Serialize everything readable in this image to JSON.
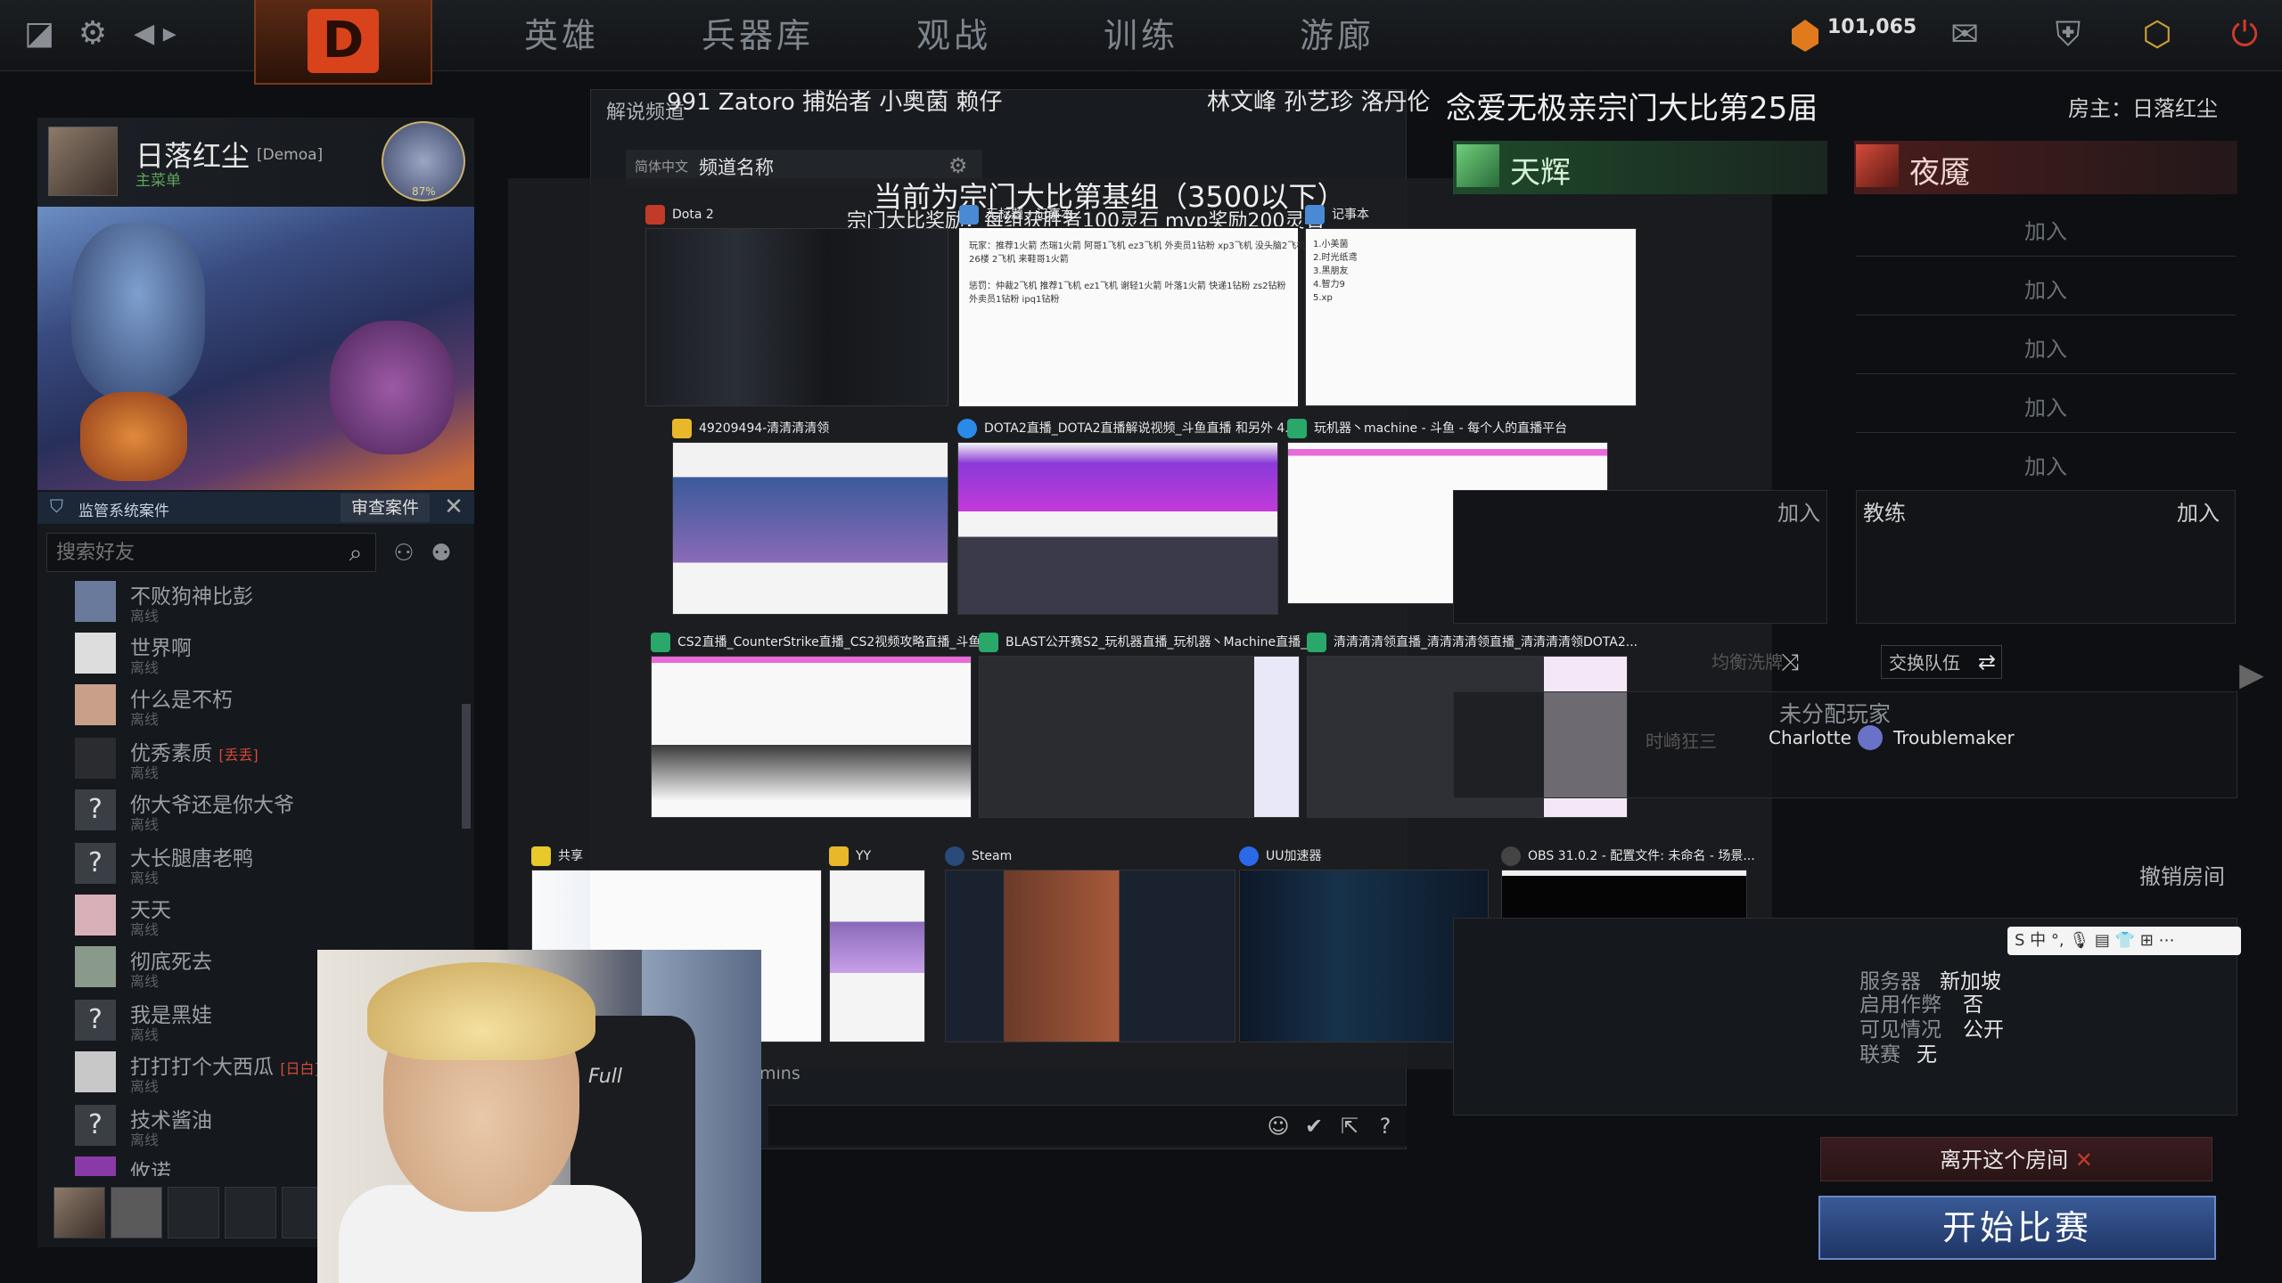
{
  "topbar": {
    "tabs": [
      "英雄",
      "兵器库",
      "观战",
      "训练",
      "游廊"
    ],
    "coins": "101,065"
  },
  "profile": {
    "name": "日落红尘",
    "tag": "[Demoa]",
    "menu": "主菜单",
    "badge_percent": "87%"
  },
  "report": {
    "label": "监管系统案件",
    "button": "审查案件"
  },
  "friends": {
    "search_placeholder": "搜索好友",
    "items": [
      {
        "name": "不败狗神比彭",
        "status": "离线",
        "clan": ""
      },
      {
        "name": "世界啊",
        "status": "离线",
        "clan": ""
      },
      {
        "name": "什么是不朽",
        "status": "离线",
        "clan": ""
      },
      {
        "name": "优秀素质",
        "status": "离线",
        "clan": "[丢丢]"
      },
      {
        "name": "你大爷还是你大爷",
        "status": "离线",
        "clan": ""
      },
      {
        "name": "大长腿唐老鸭",
        "status": "离线",
        "clan": ""
      },
      {
        "name": "天天",
        "status": "离线",
        "clan": ""
      },
      {
        "name": "彻底死去",
        "status": "离线",
        "clan": ""
      },
      {
        "name": "我是黑娃",
        "status": "离线",
        "clan": ""
      },
      {
        "name": "打打打个大西瓜",
        "status": "离线",
        "clan": "[日白]"
      },
      {
        "name": "技术酱油",
        "status": "离线",
        "clan": ""
      },
      {
        "name": "攸诺",
        "status": "",
        "clan": ""
      }
    ]
  },
  "room": {
    "tab_header": "解说频道",
    "viewers_left": "991  Zatoro  捕始者  小奥菌  赖仔",
    "viewers_right": "林文峰  孙艺珍  洛丹伦",
    "channel_lang": "简体中文",
    "channel_name": "频道名称",
    "mins_text": "mins",
    "title": "念爱无极亲宗门大比第25届",
    "host": "房主：日落红尘",
    "radiant": "天辉",
    "dire": "夜魇",
    "join": "加入",
    "coach": "教练",
    "balance": "均衡洗牌",
    "swap": "交换队伍",
    "unassigned_title": "未分配玩家",
    "unassigned": [
      "时崎狂三",
      "Charlotte",
      "Troublemaker"
    ],
    "cancel": "撤销房间",
    "info": [
      {
        "k": "服务器",
        "v": "新加坡"
      },
      {
        "k": "启用作弊",
        "v": "否"
      },
      {
        "k": "可见情况",
        "v": "公开"
      },
      {
        "k": "联赛",
        "v": "无"
      }
    ],
    "leave": "离开这个房间",
    "start": "开始比赛",
    "ime": "S 中 °, 🎙 ▤ 👕 ⊞ ⋯"
  },
  "switcher": {
    "title": "当前为宗门大比第基组（3500以下）",
    "subtitle": "宗门大比奖励：每组获胜者100灵石 mvp奖励200灵石",
    "windows": [
      {
        "title": "Dota 2",
        "icon_color": "#c23a2a"
      },
      {
        "title": "无标题 - 记事本",
        "icon_color": "#4a8ad4"
      },
      {
        "title": "记事本",
        "icon_color": "#4a8ad4"
      },
      {
        "title": "49209494-清清清清领",
        "icon_color": "#e8b82a"
      },
      {
        "title": "DOTA2直播_DOTA2直播解说视频_斗鱼直播 和另外 4...",
        "icon_color": "#2a8ae8"
      },
      {
        "title": "玩机器丶machine - 斗鱼 - 每个人的直播平台",
        "icon_color": "#2aa86a"
      },
      {
        "title": "CS2直播_CounterStrike直播_CS2视频攻略直播_斗鱼...",
        "icon_color": "#2aa86a"
      },
      {
        "title": "BLAST公开赛S2_玩机器直播_玩机器丶Machine直播_...",
        "icon_color": "#2aa86a"
      },
      {
        "title": "清清清清领直播_清清清清领直播_清清清清领DOTA2...",
        "icon_color": "#2aa86a"
      },
      {
        "title": "共享",
        "icon_color": "#e8c82a"
      },
      {
        "title": "YY",
        "icon_color": "#e8b82a"
      },
      {
        "title": "Steam",
        "icon_color": "#2a4a7a"
      },
      {
        "title": "UU加速器",
        "icon_color": "#2a6ae8"
      },
      {
        "title": "OBS 31.0.2 - 配置文件: 未命名 - 场景...",
        "icon_color": "#444"
      }
    ],
    "notepad1": "玩家：推荐1火箭 杰瑞1火箭 阿哥1飞机 ez3飞机 外卖员1钻粉 xp3飞机 没头脑2飞机\n26楼 2飞机 来鞋哥1火箭\n\n惩罚：仲裁2飞机 推荐1飞机 ez1飞机 谢轻1火箭 叶落1火箭 快递1钻粉 zs2钻粉\n外卖员1钻粉 ipq1钻粉",
    "notepad2": "1.小美菌\n2.时光纸鸢\n3.黑朋友\n4.智力9\n5.xp"
  },
  "webcam": {
    "chair_text": "Full"
  }
}
